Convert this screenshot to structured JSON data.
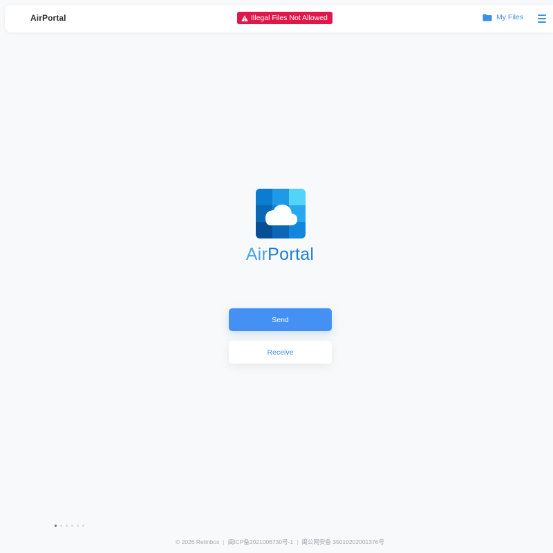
{
  "header": {
    "brand": "AirPortal",
    "warning": "Illegal Files Not Allowed",
    "my_files": "My Files"
  },
  "logo": {
    "text_air": "Air",
    "text_portal": "Portal"
  },
  "actions": {
    "send": "Send",
    "receive": "Receive"
  },
  "pager": {
    "count": 6,
    "active_index": 0
  },
  "footer": {
    "copyright": "© 2026 Retinbox",
    "icp": "闽ICP备2021006730号-1",
    "police": "闽公网安备 35010202001376号"
  },
  "colors": {
    "accent": "#4591f3",
    "link": "#3b8fe8",
    "warning_bg": "#e0174a"
  },
  "icons": {
    "warning": "warning-triangle-icon",
    "folder": "folder-icon",
    "menu": "hamburger-menu-icon",
    "logo": "cloud-logo-icon"
  }
}
